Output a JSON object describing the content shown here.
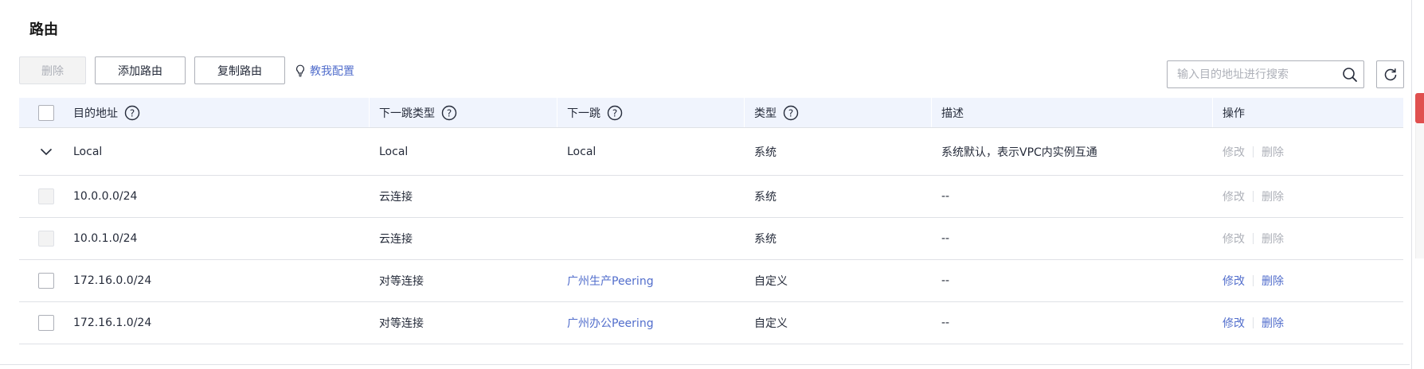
{
  "page": {
    "title": "路由"
  },
  "toolbar": {
    "delete_label": "删除",
    "add_label": "添加路由",
    "copy_label": "复制路由",
    "help_label": "教我配置"
  },
  "search": {
    "placeholder": "输入目的地址进行搜索",
    "value": ""
  },
  "icons": {
    "help": "question-circle-icon",
    "search": "search-icon",
    "refresh": "refresh-icon",
    "bulb": "lightbulb-icon",
    "expand": "chevron-down-icon"
  },
  "colors": {
    "link": "#526ecc",
    "header_bg": "#f0f4fd",
    "disabled": "#adb0b8",
    "border": "#dfe1e6"
  },
  "table": {
    "headers": {
      "destination": "目的地址",
      "next_hop_type": "下一跳类型",
      "next_hop": "下一跳",
      "type": "类型",
      "description": "描述",
      "actions": "操作"
    },
    "rows": [
      {
        "destination": "Local",
        "next_hop_type": "Local",
        "next_hop": "Local",
        "type": "系统",
        "description": "系统默认，表示VPC内实例互通",
        "modify": "修改",
        "delete": "删除"
      },
      {
        "destination": "10.0.0.0/24",
        "next_hop_type": "云连接",
        "next_hop": "",
        "type": "系统",
        "description": "--",
        "modify": "修改",
        "delete": "删除"
      },
      {
        "destination": "10.0.1.0/24",
        "next_hop_type": "云连接",
        "next_hop": "",
        "type": "系统",
        "description": "--",
        "modify": "修改",
        "delete": "删除"
      },
      {
        "destination": "172.16.0.0/24",
        "next_hop_type": "对等连接",
        "next_hop": "广州生产Peering",
        "type": "自定义",
        "description": "--",
        "modify": "修改",
        "delete": "删除"
      },
      {
        "destination": "172.16.1.0/24",
        "next_hop_type": "对等连接",
        "next_hop": "广州办公Peering",
        "type": "自定义",
        "description": "--",
        "modify": "修改",
        "delete": "删除"
      }
    ]
  }
}
